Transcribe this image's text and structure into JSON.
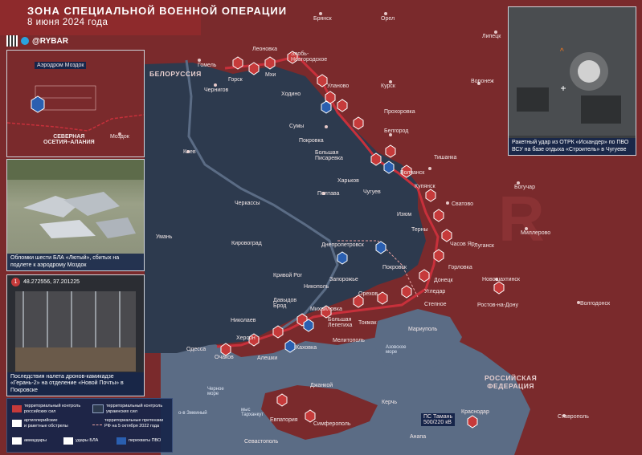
{
  "header": {
    "title": "ЗОНА СПЕЦИАЛЬНОЙ ВОЕННОЙ ОПЕРАЦИИ",
    "date": "8 июня 2024 года",
    "brand": "@RYBAR"
  },
  "colors": {
    "russia": "#7a2a2c",
    "ukraine": "#2d3a4e",
    "sea": "#5b6c85",
    "frontline": "#c8303b",
    "panel_caption": "#16254a"
  },
  "inset_mozdok": {
    "airfield_label": "Аэродром Моздок",
    "region_label": "СЕВЕРНАЯ\nОСЕТИЯ–АЛАНИЯ",
    "city_label": "Моздок"
  },
  "photo_debris": {
    "caption": "Обломки шести БЛА «Лютый», сбитых на подлете к аэродрому Моздок"
  },
  "photo_pokrovsk": {
    "badge": "1",
    "coords": "48.272556, 37.201225",
    "caption": "Последствия налета дронов-камикадзе «Герань-2» на отделение «Новой Почты» в Покровске"
  },
  "thermal": {
    "caption": "Ракетный удар из ОТРК «Искандер» по ПВО ВСУ на базе отдыха «Строитель» в Чугуеве"
  },
  "regions": {
    "belarus": "БЕЛОРУССИЯ",
    "russia": "РОССИЙСКАЯ\nФЕДЕРАЦИЯ",
    "azov": "Азовское\nморе",
    "black": "Черное\nморе",
    "zmeiny": "о-в Змеиный",
    "tarkhankut": "мыс\nТарханкут"
  },
  "cities": [
    "Брянск",
    "Орел",
    "Липецк",
    "Леоновка",
    "Злобь-\nНовгородское",
    "Курск",
    "Воронеж",
    "Гомель",
    "Горск",
    "Мхи",
    "Чернигов",
    "Ходино",
    "Уланово",
    "Прохоровка",
    "Сумы",
    "Белгород",
    "Покровка",
    "Большая\nПисаревка",
    "Тишанка",
    "Харьков",
    "Волчанск",
    "Чугуев",
    "Купянск",
    "Сватово",
    "Богучар",
    "Киев",
    "Полтава",
    "Изюм",
    "Миллерово",
    "Черкассы",
    "Умань",
    "Кировоград",
    "Днепропетровск",
    "Терны",
    "Часов Яр",
    "Луганск",
    "Покровск",
    "Горловка",
    "Кривой Рог",
    "Запорожье",
    "Донецк",
    "Новошахтинск",
    "Никополь",
    "Угледар",
    "Орехов",
    "Степное",
    "Ростов-на-Дону",
    "Волгодонск",
    "Давыдов\nБрод",
    "Михайловка",
    "Николаев",
    "Большая\nЛепетиха",
    "Токмак",
    "Мариуполь",
    "Херсон",
    "Каховка",
    "Одесса",
    "Алешки",
    "Очаков",
    "Мелитополь",
    "Джанкой",
    "Керчь",
    "Краснодар",
    "Ставрополь",
    "Евпатория",
    "Симферополь",
    "Севастополь",
    "Анапа"
  ],
  "special_labels": {
    "ps_taman": "ПС Тамань\n500/220 кВ"
  },
  "legend": {
    "items": [
      {
        "label": "территориальный контроль\nроссийских сил"
      },
      {
        "label": "территориальный контроль\nукраинских сил"
      },
      {
        "label": "артиллерийские\nи ракетные обстрелы"
      },
      {
        "label": "территориальные претензии\nРФ на 5 октября 2022 года"
      },
      {
        "label": "авиаудары"
      },
      {
        "label": "удары БЛА"
      },
      {
        "label": "перехваты ПВО"
      }
    ]
  }
}
